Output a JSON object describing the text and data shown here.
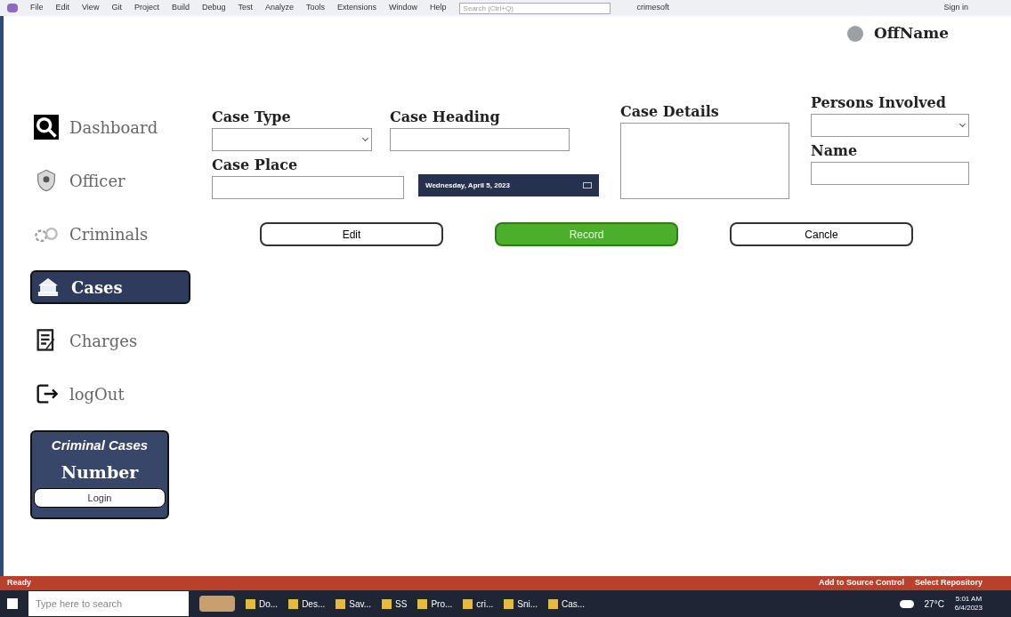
{
  "menu_bar": {
    "items": [
      "File",
      "Edit",
      "View",
      "Git",
      "Project",
      "Build",
      "Debug",
      "Test",
      "Analyze",
      "Tools",
      "Extensions",
      "Window",
      "Help"
    ],
    "search_placeholder": "Search (Ctrl+Q)",
    "solution": "crimesoft",
    "sign_in": "Sign in"
  },
  "header": {
    "user": "OffName"
  },
  "sidebar": {
    "items": [
      {
        "label": "Dashboard",
        "kind": "search",
        "selected": false
      },
      {
        "label": "Officer",
        "kind": "badge",
        "selected": false
      },
      {
        "label": "Criminals",
        "kind": "handcuffs",
        "selected": false
      },
      {
        "label": "Cases",
        "kind": "building",
        "selected": true
      },
      {
        "label": "Charges",
        "kind": "document",
        "selected": false
      },
      {
        "label": "logOut",
        "kind": "logout",
        "selected": false
      }
    ],
    "card": {
      "title": "Criminal Cases",
      "value": "Number",
      "button": "Login"
    }
  },
  "form": {
    "case_type": {
      "label": "Case Type"
    },
    "case_heading": {
      "label": "Case Heading"
    },
    "case_place": {
      "label": "Case Place"
    },
    "date": {
      "value": "Wednesday, April 5, 2023"
    },
    "case_details": {
      "label": "Case Details"
    },
    "persons_involved": {
      "label": "Persons Involved"
    },
    "name": {
      "label": "Name"
    },
    "buttons": [
      {
        "label": "Edit",
        "kind": "outline"
      },
      {
        "label": "Record",
        "kind": "primary"
      },
      {
        "label": "Cancle",
        "kind": "outline"
      }
    ]
  },
  "status_bar": {
    "text": "Ready",
    "source_control": "Add to Source Control",
    "repository": "Select Repository"
  },
  "taskbar": {
    "search_placeholder": "Type here to search",
    "apps": [
      "Do...",
      "Des...",
      "Sav...",
      "SS",
      "Pro...",
      "cri...",
      "Sni...",
      "Cas..."
    ],
    "weather": "27°C",
    "time": "5:01 AM",
    "date": "6/4/2023"
  }
}
